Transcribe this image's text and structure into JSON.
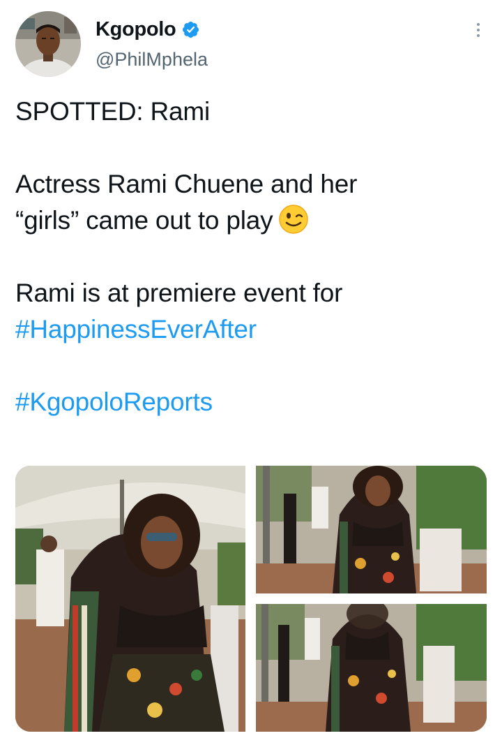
{
  "author": {
    "display_name": "Kgopolo",
    "handle": "@PhilMphela",
    "avatar_icon": "profile-photo",
    "verified_icon": "verified-badge-icon"
  },
  "tweet": {
    "line1": "SPOTTED: Rami",
    "line2": "Actress Rami Chuene and her",
    "line3": "“girls” came out to play",
    "line4": "Rami is at premiere event for",
    "hashtag1": "#HappinessEverAfter",
    "hashtag2": "#KgopoloReports",
    "emoji": "winking-face-emoji"
  },
  "media": {
    "count": 3,
    "photos": [
      "photo-woman-floral-outfit-umbrella",
      "photo-woman-floral-outfit-garden",
      "photo-woman-floral-outfit-garden-blurred"
    ]
  },
  "colors": {
    "link": "#1d9bf0",
    "text": "#0f1419",
    "secondary": "#536471"
  }
}
